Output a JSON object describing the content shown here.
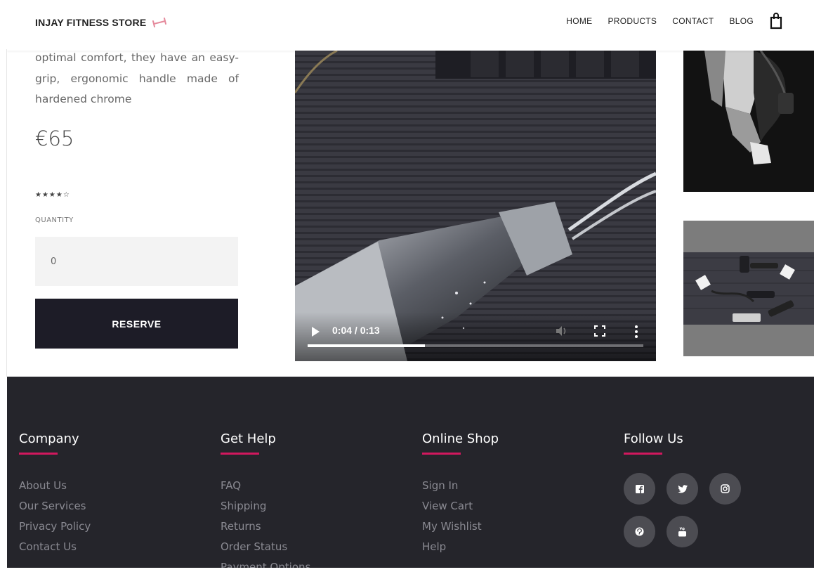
{
  "header": {
    "logo_text": "INJAY FITNESS STORE",
    "logo_icon": "dumbbell-icon",
    "nav": [
      "HOME",
      "PRODUCTS",
      "CONTACT",
      "BLOG"
    ],
    "cart_icon": "shopping-bag-icon"
  },
  "product": {
    "description": "optimal comfort, they have an easy-grip, ergonomic handle made of hardened chrome",
    "price": "€65",
    "rating_stars": "★★★★☆",
    "rating": 4,
    "rating_max": 5,
    "quantity_label": "QUANTITY",
    "quantity_value": "0",
    "reserve_label": "RESERVE"
  },
  "video": {
    "time": "0:04 / 0:13",
    "progress": 0.35,
    "controls": [
      "play-icon",
      "volume-icon",
      "fullscreen-icon",
      "more-options-icon"
    ]
  },
  "footer": {
    "company": {
      "title": "Company",
      "links": [
        "About Us",
        "Our Services",
        "Privacy Policy",
        "Contact Us"
      ]
    },
    "help": {
      "title": "Get Help",
      "links": [
        "FAQ",
        "Shipping",
        "Returns",
        "Order Status",
        "Payment Options"
      ]
    },
    "shop": {
      "title": "Online Shop",
      "links": [
        "Sign In",
        "View Cart",
        "My Wishlist",
        "Help"
      ]
    },
    "follow": {
      "title": "Follow Us",
      "icons": [
        "facebook-icon",
        "twitter-icon",
        "instagram-icon",
        "pinterest-icon",
        "youtube-icon"
      ]
    }
  },
  "colors": {
    "footer_bg": "#25252b",
    "accent": "#d1185e",
    "button_bg": "#1d1c27"
  }
}
